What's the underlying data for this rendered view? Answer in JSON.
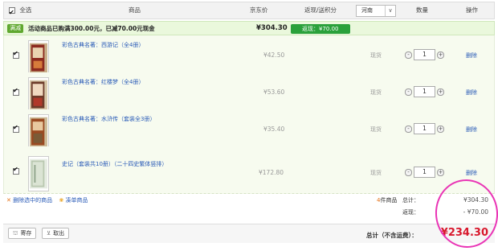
{
  "header": {
    "select_all": "全选",
    "col_product": "商品",
    "col_jd_price": "京东价",
    "col_rebate": "返现/送积分",
    "region": "河南",
    "col_qty": "数量",
    "col_action": "操作"
  },
  "promo": {
    "tag": "满减",
    "text": "活动商品已购满300.00元，已减70.00元现金",
    "total": "¥304.30",
    "rebate": "返现：¥70.00"
  },
  "items": [
    {
      "name": "彩色古典名著：西游记（全4册）",
      "price": "¥42.50",
      "stock": "现货",
      "qty": "1",
      "delete": "删除"
    },
    {
      "name": "彩色古典名著：红楼梦（全4册）",
      "price": "¥53.60",
      "stock": "现货",
      "qty": "1",
      "delete": "删除"
    },
    {
      "name": "彩色古典名著：水浒传（套装全3册）",
      "price": "¥35.40",
      "stock": "现货",
      "qty": "1",
      "delete": "删除"
    },
    {
      "name": "史记（套装共10册）（二十四史繁体竖排）",
      "price": "¥172.80",
      "stock": "现货",
      "qty": "1",
      "delete": "删除"
    }
  ],
  "summary": {
    "delete_selected": "删除选中的商品",
    "favorite": "凑单商品",
    "count": "4",
    "count_suffix": "件商品",
    "total_label": "总计：",
    "total_value": "¥304.30",
    "rebate_label": "返现：",
    "rebate_value": "- ¥70.00",
    "save_button": "寄存",
    "retrieve_button": "取出",
    "grand_label": "总计（不含运费）：",
    "grand_value": "¥234.30"
  },
  "colors": {
    "accent": "#d8172c",
    "promo_green": "#2aa13b",
    "link": "#2a5bb7",
    "highlight_ring": "#e934b5"
  }
}
